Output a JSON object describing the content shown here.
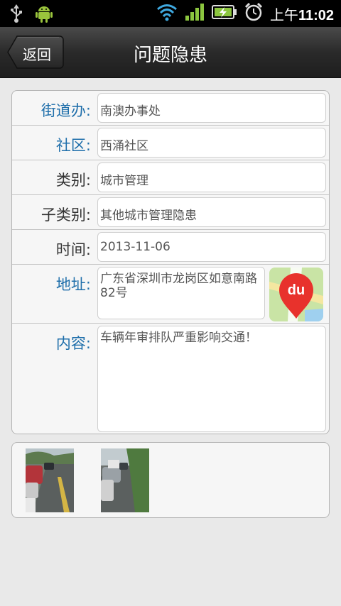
{
  "status_bar": {
    "time_prefix": "上午",
    "time": "11:02",
    "icons": [
      "usb-icon",
      "android-debug-icon",
      "wifi-icon",
      "signal-icon",
      "battery-charging-icon",
      "alarm-clock-icon"
    ]
  },
  "header": {
    "back_label": "返回",
    "title": "问题隐患"
  },
  "form": {
    "street_office": {
      "label": "街道办:",
      "value": "南澳办事处"
    },
    "community": {
      "label": "社区:",
      "value": "西涌社区"
    },
    "category": {
      "label": "类别:",
      "value": "城市管理"
    },
    "subcategory": {
      "label": "子类别:",
      "value": "其他城市管理隐患"
    },
    "time": {
      "label": "时间:",
      "value": "2013-11-06"
    },
    "address": {
      "label": "地址:",
      "value": "广东省深圳市龙岗区如意南路82号"
    },
    "content": {
      "label": "内容:",
      "value": "车辆年审排队严重影响交通！"
    }
  },
  "map_button": {
    "icon": "baidu-map-icon",
    "text": "du"
  },
  "photos": [
    "photo-thumbnail-1",
    "photo-thumbnail-2"
  ],
  "colors": {
    "label_blue": "#1e6eaa",
    "label_gray": "#333333",
    "map_red": "#e8322c"
  }
}
